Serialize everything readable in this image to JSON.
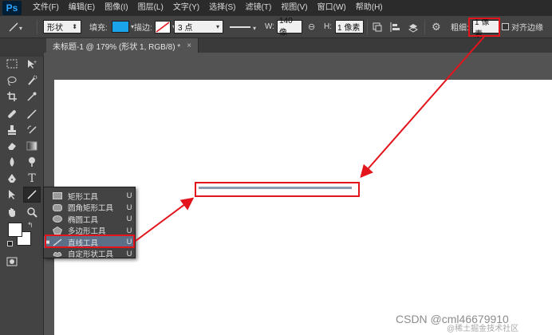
{
  "app": {
    "logo": "Ps",
    "menu": [
      "文件(F)",
      "编辑(E)",
      "图像(I)",
      "图层(L)",
      "文字(Y)",
      "选择(S)",
      "滤镜(T)",
      "视图(V)",
      "窗口(W)",
      "帮助(H)"
    ]
  },
  "options": {
    "tool_mode": "形状",
    "fill_label": "填充:",
    "fill_color": "#1aa3e8",
    "stroke_label": "描边:",
    "stroke_size": "3 点",
    "w_label": "W:",
    "w_value": "140 像",
    "h_label": "H:",
    "h_value": "1 像素",
    "weight_label": "粗细:",
    "weight_value": "1 像素",
    "align_edges_label": "对齐边缘"
  },
  "document": {
    "tab_title": "未标题-1 @ 179% (形状 1, RGB/8) *",
    "close": "×"
  },
  "flyout": {
    "items": [
      {
        "label": "矩形工具",
        "shortcut": "U",
        "icon": "rectangle-icon",
        "selected": false
      },
      {
        "label": "圆角矩形工具",
        "shortcut": "U",
        "icon": "rounded-rectangle-icon",
        "selected": false
      },
      {
        "label": "椭圆工具",
        "shortcut": "U",
        "icon": "ellipse-icon",
        "selected": false
      },
      {
        "label": "多边形工具",
        "shortcut": "U",
        "icon": "polygon-icon",
        "selected": false
      },
      {
        "label": "直线工具",
        "shortcut": "U",
        "icon": "line-icon",
        "selected": true
      },
      {
        "label": "自定形状工具",
        "shortcut": "U",
        "icon": "custom-shape-icon",
        "selected": false
      }
    ]
  },
  "colors": {
    "annotation": "#e3141b",
    "selection": "#5c6f87",
    "line_shape": "#8a9bb3"
  },
  "watermark": {
    "text": "CSDN @cml46679910",
    "sub": "@稀土掘金技术社区"
  }
}
